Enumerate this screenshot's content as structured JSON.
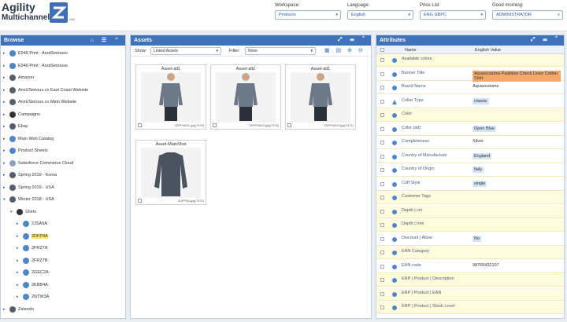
{
  "header": {
    "logo_line1": "Agility",
    "logo_line2": "Multichannel",
    "logo_sub": "AMI",
    "workspace": {
      "label": "Workspace:",
      "value": "Products"
    },
    "language": {
      "label": "Language:",
      "value": "English"
    },
    "price_list": {
      "label": "Price List",
      "value": "ENG GBPC"
    },
    "greeting": {
      "label": "Good morning:",
      "value": "ADMINISTRATOR"
    }
  },
  "browse": {
    "title": "Browse",
    "items": [
      {
        "label": "E946 Print : AnotSeriouso",
        "icon": "product"
      },
      {
        "label": "E946 Print : AnotSeriouse",
        "icon": "product"
      },
      {
        "label": "Amazon",
        "icon": "globe"
      },
      {
        "label": "AnsUSerious.co East Coast Website",
        "icon": "globe"
      },
      {
        "label": "AnsUSerious.co Main Website",
        "icon": "globe"
      },
      {
        "label": "Campaigns",
        "icon": "folder"
      },
      {
        "label": "Ebay",
        "icon": "globe"
      },
      {
        "label": "Main Web Catalog",
        "icon": "product"
      },
      {
        "label": "Product Sheets",
        "icon": "product"
      },
      {
        "label": "Salesforce Commerce Cloud",
        "icon": "cloud"
      },
      {
        "label": "Spring 2019 - Korea",
        "icon": "globe"
      },
      {
        "label": "Spring 2019 - USA",
        "icon": "globe"
      },
      {
        "label": "Winter 2018 - USA",
        "icon": "globe"
      },
      {
        "label": "Shirts",
        "icon": "folder"
      },
      {
        "label": "2JSA9A",
        "icon": "product"
      },
      {
        "label": "2DFP4A",
        "icon": "product",
        "highlight": true
      },
      {
        "label": "2FRZ7A",
        "icon": "product"
      },
      {
        "label": "2FRZ7B",
        "icon": "product"
      },
      {
        "label": "2GEC2A",
        "icon": "product"
      },
      {
        "label": "2KBB4A",
        "icon": "product"
      },
      {
        "label": "2NTW3A",
        "icon": "product"
      },
      {
        "label": "Zalando",
        "icon": "globe"
      }
    ]
  },
  "assets": {
    "title": "Assets",
    "show_label": "Show:",
    "show_value": "Linked Assets",
    "filter_label": "Filter:",
    "filter_value": "None",
    "cards": [
      {
        "title": "Asset-alt1",
        "file": "2DFP4A01.jpg(?476)"
      },
      {
        "title": "Asset-alt2",
        "file": "2DFP4A02.jpg(?476)"
      },
      {
        "title": "Asset-alt1",
        "file": "2DFP4A03.jpg(?471)"
      },
      {
        "title": "Asset-MainShot",
        "file": "2DFP4A.jpg(?472)"
      }
    ]
  },
  "attributes": {
    "title": "Attributes",
    "col_name": "Name",
    "col_value": "English Value",
    "rows": [
      {
        "name": "Available colors",
        "value": ""
      },
      {
        "name": "Banner Title",
        "value": "Aquascutums Paddtow Check Linen Cotton Shirt",
        "style": "orange"
      },
      {
        "name": "Brand Name",
        "value": "Aquascutums"
      },
      {
        "name": "Collar Type",
        "value": "classic",
        "style": "chip",
        "tri": true
      },
      {
        "name": "Color",
        "value": ""
      },
      {
        "name": "Color (alt)",
        "value": "Open Blue",
        "style": "chip"
      },
      {
        "name": "Completeness",
        "value": "Silver"
      },
      {
        "name": "Country of Manufacture",
        "value": "England",
        "style": "chip"
      },
      {
        "name": "Country of Origin",
        "value": "Italy",
        "style": "chip"
      },
      {
        "name": "Cuff Style",
        "value": "single",
        "style": "chip"
      },
      {
        "name": "Customer Tags",
        "value": ""
      },
      {
        "name": "Depth | cm",
        "value": ""
      },
      {
        "name": "Depth | mm",
        "value": ""
      },
      {
        "name": "Discount | Allow",
        "value": "No",
        "style": "chip"
      },
      {
        "name": "EAN Category",
        "value": ""
      },
      {
        "name": "EAN code",
        "value": "98765432107"
      },
      {
        "name": "ERP | Product | Description",
        "value": ""
      },
      {
        "name": "ERP | Product | EAN",
        "value": ""
      },
      {
        "name": "ERP | Product | Stock Level",
        "value": ""
      }
    ]
  }
}
